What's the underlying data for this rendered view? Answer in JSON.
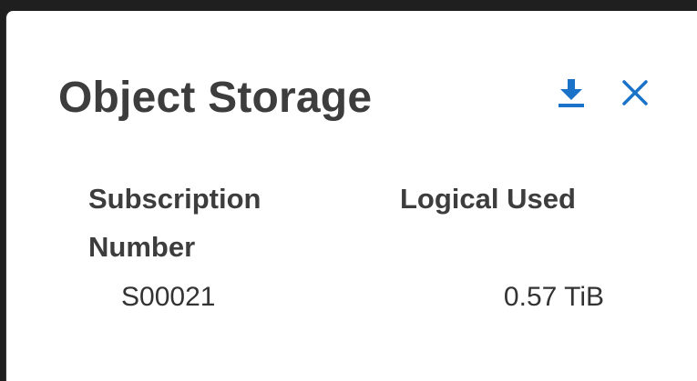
{
  "dialog": {
    "title": "Object Storage",
    "download_icon": "download-icon",
    "close_icon": "close-icon",
    "accent_color": "#1a73c8"
  },
  "table": {
    "headers": {
      "subscription_line1": "Subscription",
      "subscription_line2": "Number",
      "logical_used": "Logical Used"
    },
    "rows": [
      {
        "subscription_number": "S00021",
        "logical_used": "0.57 TiB"
      }
    ]
  }
}
